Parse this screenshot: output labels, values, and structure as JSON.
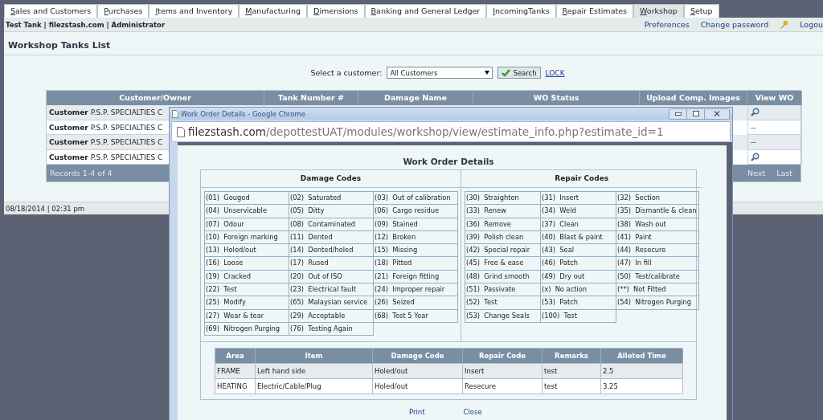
{
  "tabs": [
    {
      "label": "Sales and Customers",
      "selected": false
    },
    {
      "label": "Purchases",
      "selected": false
    },
    {
      "label": "Items and Inventory",
      "selected": false
    },
    {
      "label": "Manufacturing",
      "selected": false
    },
    {
      "label": "Dimensions",
      "selected": false
    },
    {
      "label": "Banking and General Ledger",
      "selected": false
    },
    {
      "label": "IncomingTanks",
      "selected": false
    },
    {
      "label": "Repair Estimates",
      "selected": false
    },
    {
      "label": "Workshop",
      "selected": true
    },
    {
      "label": "Setup",
      "selected": false
    }
  ],
  "header": {
    "site": "Test Tank | filezstash.com | Administrator",
    "links": [
      "Preferences",
      "Change password",
      "Logou"
    ]
  },
  "page": {
    "title": "Workshop Tanks List",
    "filter": {
      "label": "Select a customer:",
      "value": "All Customers",
      "button": "Search",
      "link": "LOCK"
    }
  },
  "tanks_table": {
    "columns": [
      "Customer/Owner",
      "Tank Number #",
      "Damage Name",
      "WO Status",
      "Upload Comp. Images",
      "View WO"
    ],
    "rows": [
      {
        "customer_label": "Customer",
        "customer": "P.S.P. SPECIALTIES C",
        "view_wo": {
          "kind": "icon"
        }
      },
      {
        "customer_label": "Customer",
        "customer": "P.S.P. SPECIALTIES C",
        "view_wo": {
          "kind": "text",
          "text": "--"
        }
      },
      {
        "customer_label": "Customer",
        "customer": "P.S.P. SPECIALTIES C",
        "view_wo": {
          "kind": "text",
          "text": "--"
        }
      },
      {
        "customer_label": "Customer",
        "customer": "P.S.P. SPECIALTIES C",
        "view_wo": {
          "kind": "icon"
        }
      }
    ],
    "footer": "Records 1-4 of 4",
    "pager": [
      "Next",
      "Last"
    ]
  },
  "status_bar": "08/18/2014 | 02:31 pm",
  "popup": {
    "title": "Work Order Details - Google Chrome",
    "url_host": "filezstash.com",
    "url_path": "/depottestUAT/modules/workshop/view/estimate_info.php?estimate_id=1",
    "heading": "Work Order Details",
    "damage_codes": {
      "title": "Damage Codes",
      "items": [
        "(01)  Gouged",
        "(02)  Saturated",
        "(03)  Out of calibration",
        "(04)  Unservicable",
        "(05)  Ditty",
        "(06)  Cargo residue",
        "(07)  Odour",
        "(08)  Contaminated",
        "(09)  Stained",
        "(10)  Foreign marking",
        "(11)  Dented",
        "(12)  Broken",
        "(13)  Holed/out",
        "(14)  Dented/holed",
        "(15)  Missing",
        "(16)  Loose",
        "(17)  Rused",
        "(18)  Pitted",
        "(19)  Cracked",
        "(20)  Out of ISO",
        "(21)  Foreign fitting",
        "(22)  Test",
        "(23)  Electrical fault",
        "(24)  Improper repair",
        "(25)  Modify",
        "(65)  Malaysian service",
        "(26)  Seized",
        "(27)  Wear & tear",
        "(29)  Acceptable",
        "(68)  Test 5 Year",
        "(69)  Nitrogen Purging",
        "(76)  Testing Again"
      ]
    },
    "repair_codes": {
      "title": "Repair Codes",
      "items": [
        "(30)  Straighten",
        "(31)  Insert",
        "(32)  Section",
        "(33)  Renew",
        "(34)  Weld",
        "(35)  Dismantle & clean",
        "(36)  Remove",
        "(37)  Clean",
        "(38)  Wash out",
        "(39)  Polish clean",
        "(40)  Blast & paint",
        "(41)  Paint",
        "(42)  Special repair",
        "(43)  Seal",
        "(44)  Resecure",
        "(45)  Free & ease",
        "(46)  Patch",
        "(47)  In fill",
        "(48)  Grind smooth",
        "(49)  Dry out",
        "(50)  Test/calibrate",
        "(51)  Passivate",
        "(x)  No action",
        "(**)  Not Fitted",
        "(52)  Test",
        "(53)  Patch",
        "(54)  Nitrogen Purging",
        "(53)  Change Seals",
        "(100)  Test"
      ]
    },
    "table": {
      "columns": [
        "Area",
        "Item",
        "Damage Code",
        "Repair Code",
        "Remarks",
        "Alloted Time"
      ],
      "rows": [
        [
          "FRAME",
          "Left hand side",
          "Holed/out",
          "Insert",
          "test",
          "2.5"
        ],
        [
          "HEATING",
          "Electric/Cable/Plug",
          "Holed/out",
          "Resecure",
          "test",
          "3.25"
        ]
      ]
    },
    "actions": [
      "Print",
      "Close"
    ]
  }
}
